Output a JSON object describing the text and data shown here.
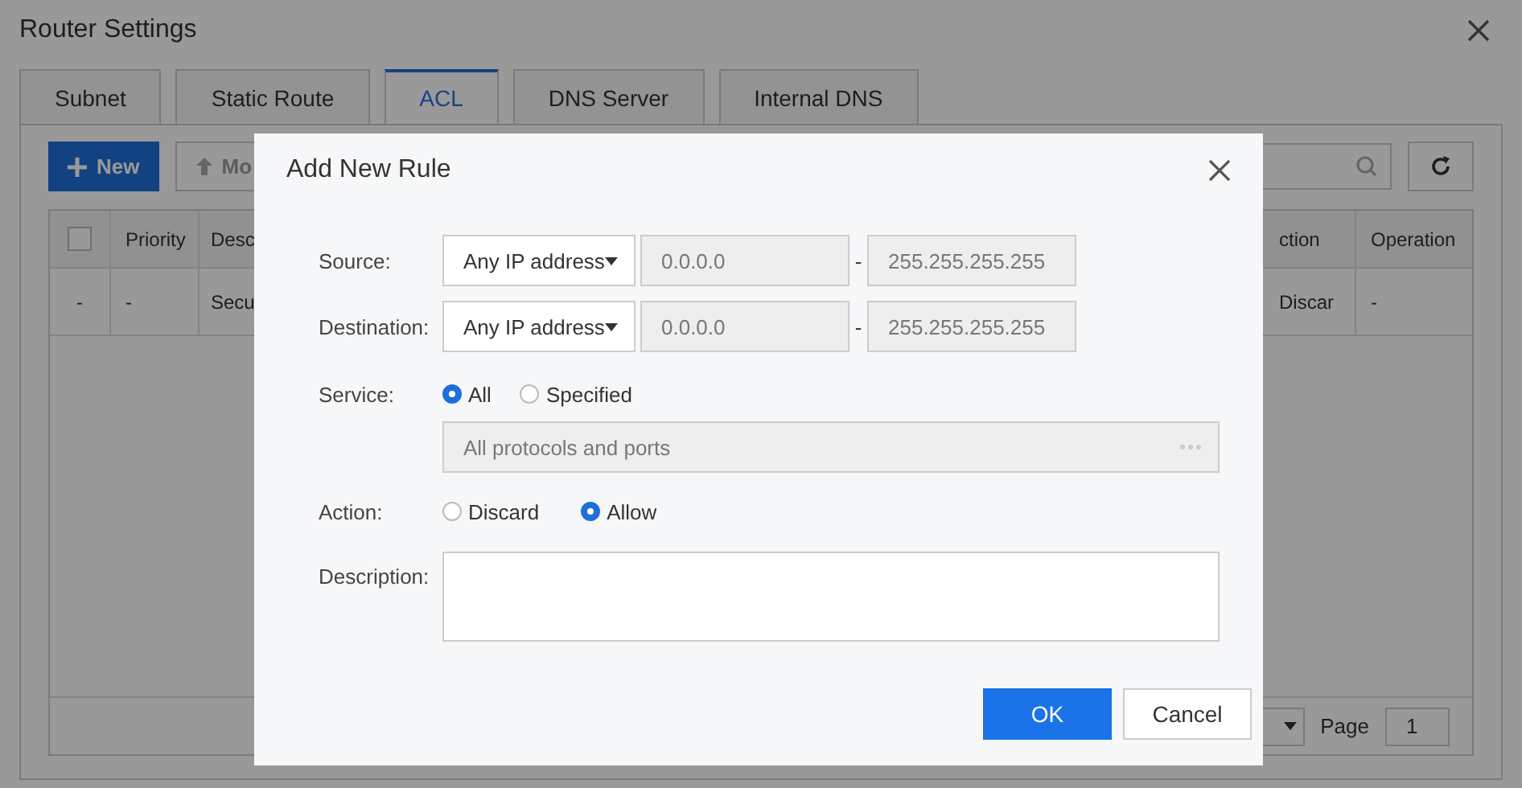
{
  "window": {
    "title": "Router Settings"
  },
  "tabs": [
    {
      "label": "Subnet",
      "selected": false
    },
    {
      "label": "Static Route",
      "selected": false
    },
    {
      "label": "ACL",
      "selected": true
    },
    {
      "label": "DNS Server",
      "selected": false
    },
    {
      "label": "Internal DNS",
      "selected": false
    }
  ],
  "toolbar": {
    "new_button": "New",
    "move_button": "Mo"
  },
  "table": {
    "columns": [
      {
        "kind": "checkbox",
        "checked": false
      },
      {
        "kind": "text",
        "label": "Priority"
      },
      {
        "kind": "text",
        "label": "Desc"
      },
      {
        "kind": "text",
        "label": "ction"
      },
      {
        "kind": "text",
        "label": "Operation"
      }
    ],
    "rows": [
      {
        "cells": [
          "-",
          "-",
          "Secu",
          "Discar",
          "-"
        ]
      }
    ]
  },
  "pagination": {
    "page_label": "Page",
    "page": "1"
  },
  "dialog": {
    "title": "Add New Rule",
    "address_rows": [
      {
        "label": "Source:",
        "type": "Any IP address",
        "start": "0.0.0.0",
        "separator": "-",
        "end": "255.255.255.255"
      },
      {
        "label": "Destination:",
        "type": "Any IP address",
        "start": "0.0.0.0",
        "separator": "-",
        "end": "255.255.255.255"
      }
    ],
    "service": {
      "label": "Service:",
      "options": [
        {
          "label": "All",
          "selected": true
        },
        {
          "label": "Specified",
          "selected": false
        }
      ],
      "value": "All protocols and ports"
    },
    "action": {
      "label": "Action:",
      "options": [
        {
          "label": "Discard",
          "selected": false
        },
        {
          "label": "Allow",
          "selected": true
        }
      ]
    },
    "description": {
      "label": "Description:"
    },
    "buttons": [
      {
        "label": "OK",
        "kind": "primary"
      },
      {
        "label": "Cancel",
        "kind": "secondary"
      }
    ]
  }
}
